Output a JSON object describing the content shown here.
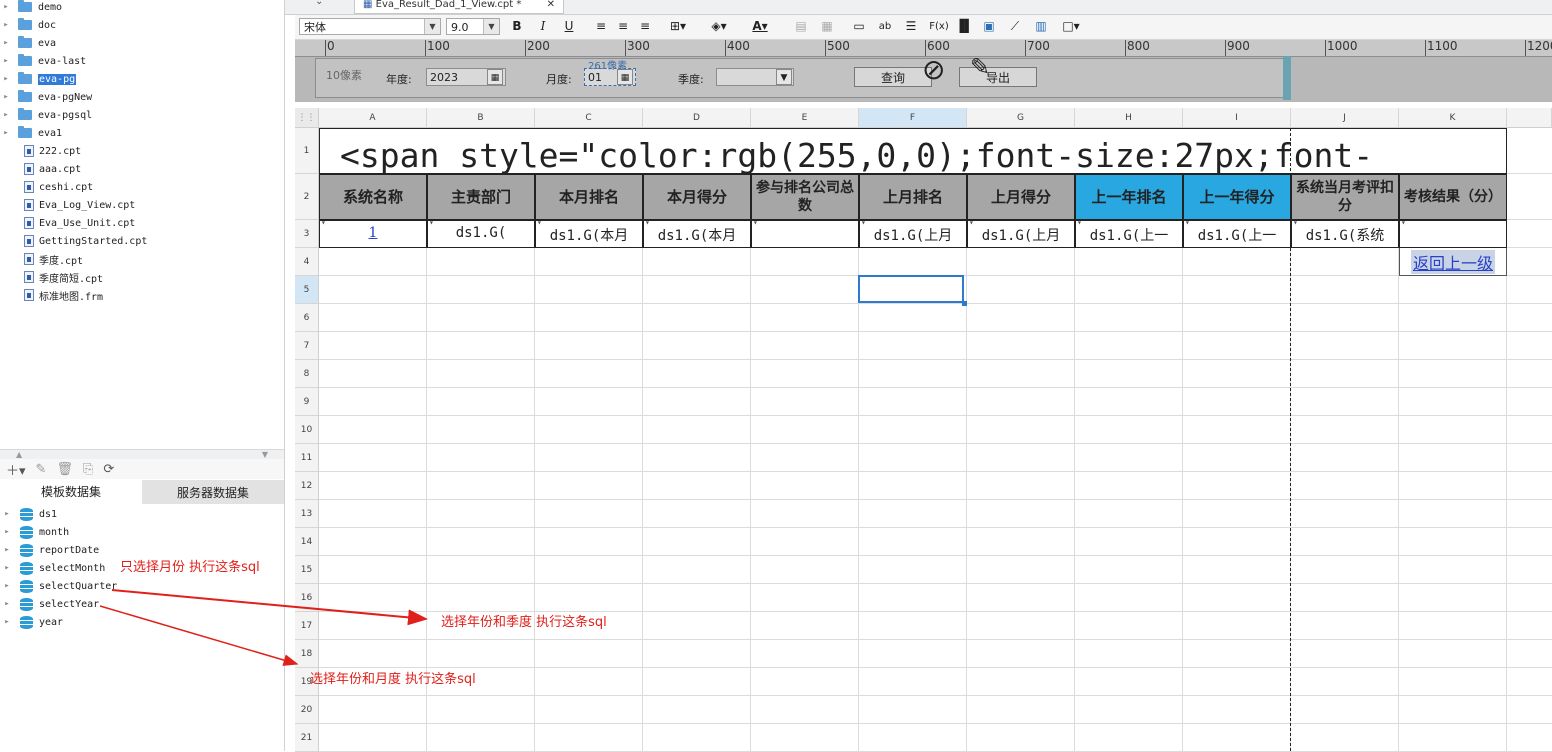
{
  "file_tree": {
    "items": [
      {
        "label": "demo",
        "type": "folder"
      },
      {
        "label": "doc",
        "type": "folder"
      },
      {
        "label": "eva",
        "type": "folder"
      },
      {
        "label": "eva-last",
        "type": "folder"
      },
      {
        "label": "eva-pg",
        "type": "folder",
        "selected": true
      },
      {
        "label": "eva-pgNew",
        "type": "folder"
      },
      {
        "label": "eva-pgsql",
        "type": "folder"
      },
      {
        "label": "eva1",
        "type": "folder"
      },
      {
        "label": "222.cpt",
        "type": "file"
      },
      {
        "label": "aaa.cpt",
        "type": "file"
      },
      {
        "label": "ceshi.cpt",
        "type": "file"
      },
      {
        "label": "Eva_Log_View.cpt",
        "type": "file"
      },
      {
        "label": "Eva_Use_Unit.cpt",
        "type": "file"
      },
      {
        "label": "GettingStarted.cpt",
        "type": "file"
      },
      {
        "label": "季度.cpt",
        "type": "file"
      },
      {
        "label": "季度简短.cpt",
        "type": "file"
      },
      {
        "label": "标准地图.frm",
        "type": "file"
      }
    ]
  },
  "dataset_panel": {
    "tabs": [
      "模板数据集",
      "服务器数据集"
    ],
    "items": [
      "ds1",
      "month",
      "reportDate",
      "selectMonth",
      "selectQuarter",
      "selectYear",
      "year"
    ]
  },
  "editor_tab": {
    "label": "Eva_Result_Dad_1_View.cpt *"
  },
  "toolbar": {
    "font_name": "宋体",
    "font_size": "9.0",
    "bold": "B",
    "italic": "I",
    "underline": "U"
  },
  "ruler": {
    "marks": [
      "0",
      "100",
      "200",
      "300",
      "400",
      "500",
      "600",
      "700",
      "800",
      "900",
      "1000",
      "1100",
      "1200"
    ]
  },
  "param_pane": {
    "height_label": "10像素",
    "width_label": "261像素",
    "year_label": "年度:",
    "year_value": "2023",
    "month_label": "月度:",
    "month_value": "01",
    "quarter_label": "季度:",
    "quarter_value": "",
    "query_button": "查询",
    "export_button": "导出"
  },
  "grid": {
    "columns": [
      "A",
      "B",
      "C",
      "D",
      "E",
      "F",
      "G",
      "H",
      "I",
      "J",
      "K"
    ],
    "rows": [
      "1",
      "2",
      "3",
      "4",
      "5",
      "6",
      "7",
      "8",
      "9",
      "10",
      "11",
      "12",
      "13",
      "14",
      "15",
      "16",
      "17",
      "18",
      "19",
      "20",
      "21"
    ],
    "title_cell": "<span style=\"color:rgb(255,0,0);font-size:27px;font-",
    "headers": [
      {
        "text": "系统名称",
        "blue": false
      },
      {
        "text": "主责部门",
        "blue": false
      },
      {
        "text": "本月排名",
        "blue": false
      },
      {
        "text": "本月得分",
        "blue": false
      },
      {
        "text": "参与排名公司总数",
        "blue": false
      },
      {
        "text": "上月排名",
        "blue": false
      },
      {
        "text": "上月得分",
        "blue": false
      },
      {
        "text": "上一年排名",
        "blue": true
      },
      {
        "text": "上一年得分",
        "blue": true
      },
      {
        "text": "系统当月考评扣分",
        "blue": false
      },
      {
        "text": "考核结果（分）",
        "blue": false
      }
    ],
    "data_row": [
      "1",
      "ds1.G(",
      "ds1.G(本月",
      "ds1.G(本月",
      "",
      "ds1.G(上月",
      "ds1.G(上月",
      "ds1.G(上一",
      "ds1.G(上一",
      "ds1.G(系统",
      ""
    ],
    "back_link": "返回上一级"
  },
  "annotations": [
    {
      "text": "只选择月份  执行这条sql"
    },
    {
      "text": "选择年份和季度  执行这条sql"
    },
    {
      "text": "选择年份和月度  执行这条sql"
    }
  ],
  "colors": {
    "header_gray": "#a6a6a6",
    "header_blue": "#29a7e1",
    "annotation_red": "#e0201a",
    "selection_blue": "#2f7bd8"
  }
}
